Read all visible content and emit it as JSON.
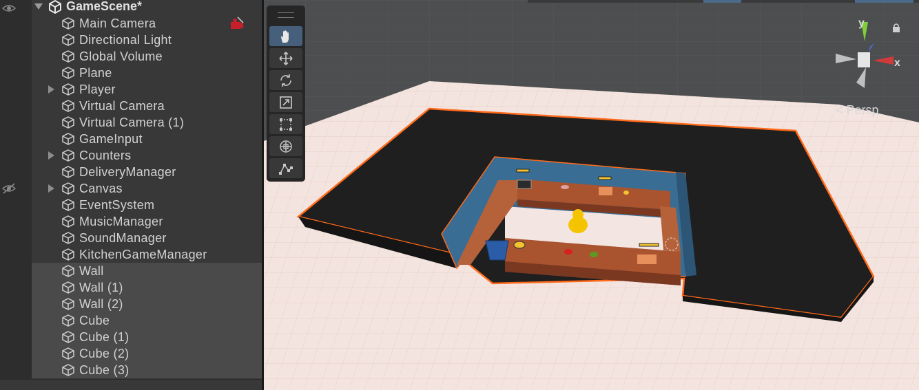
{
  "hierarchy": {
    "scene_name": "GameScene*",
    "items": [
      {
        "label": "Main Camera",
        "foldout": false,
        "selected": false
      },
      {
        "label": "Directional Light",
        "foldout": false,
        "selected": false
      },
      {
        "label": "Global Volume",
        "foldout": false,
        "selected": false
      },
      {
        "label": "Plane",
        "foldout": false,
        "selected": false
      },
      {
        "label": "Player",
        "foldout": true,
        "selected": false
      },
      {
        "label": "Virtual Camera",
        "foldout": false,
        "selected": false
      },
      {
        "label": "Virtual Camera (1)",
        "foldout": false,
        "selected": false
      },
      {
        "label": "GameInput",
        "foldout": false,
        "selected": false
      },
      {
        "label": "Counters",
        "foldout": true,
        "selected": false
      },
      {
        "label": "DeliveryManager",
        "foldout": false,
        "selected": false
      },
      {
        "label": "Canvas",
        "foldout": true,
        "selected": false
      },
      {
        "label": "EventSystem",
        "foldout": false,
        "selected": false
      },
      {
        "label": "MusicManager",
        "foldout": false,
        "selected": false
      },
      {
        "label": "SoundManager",
        "foldout": false,
        "selected": false
      },
      {
        "label": "KitchenGameManager",
        "foldout": false,
        "selected": false
      },
      {
        "label": "Wall",
        "foldout": false,
        "selected": true
      },
      {
        "label": "Wall (1)",
        "foldout": false,
        "selected": true
      },
      {
        "label": "Wall (2)",
        "foldout": false,
        "selected": true
      },
      {
        "label": "Cube",
        "foldout": false,
        "selected": true
      },
      {
        "label": "Cube (1)",
        "foldout": false,
        "selected": true
      },
      {
        "label": "Cube (2)",
        "foldout": false,
        "selected": true
      },
      {
        "label": "Cube (3)",
        "foldout": false,
        "selected": true
      }
    ]
  },
  "scene_view": {
    "projection_label": "Persp",
    "gizmo": {
      "y_label": "y",
      "x_label": "x"
    },
    "tools": [
      {
        "name": "hand-tool",
        "icon": "hand-icon",
        "active": true
      },
      {
        "name": "move-tool",
        "icon": "move-arrows-icon",
        "active": false
      },
      {
        "name": "rotate-tool",
        "icon": "rotate-icon",
        "active": false
      },
      {
        "name": "scale-tool",
        "icon": "scale-icon",
        "active": false
      },
      {
        "name": "rect-tool",
        "icon": "rect-icon",
        "active": false
      },
      {
        "name": "transform-tool",
        "icon": "transform-icon",
        "active": false
      },
      {
        "name": "custom-tool",
        "icon": "custom-editor-tool-icon",
        "active": false
      }
    ]
  },
  "colors": {
    "selection_outline": "#ff6a1a",
    "floor": "#f4e4df",
    "wall_black": "#1e1e1e",
    "kitchen_wall": "#3a6d94",
    "counter": "#a9532f",
    "active_tool": "#46607c"
  }
}
